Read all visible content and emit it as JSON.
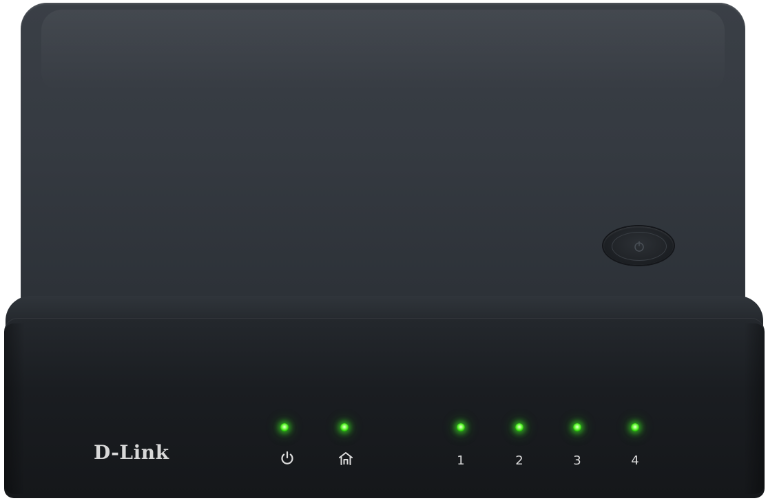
{
  "device": {
    "brand": "D-Link",
    "body_color": "#1c1f23",
    "led_color": "#4cff2a",
    "wps_button": {
      "icon": "wps-icon"
    }
  },
  "indicators": [
    {
      "id": "power",
      "icon": "power-icon",
      "label": "",
      "lit": true
    },
    {
      "id": "internet",
      "icon": "home-icon",
      "label": "",
      "lit": true
    },
    {
      "id": "port-1",
      "icon": "",
      "label": "1",
      "lit": true
    },
    {
      "id": "port-2",
      "icon": "",
      "label": "2",
      "lit": true
    },
    {
      "id": "port-3",
      "icon": "",
      "label": "3",
      "lit": true
    },
    {
      "id": "port-4",
      "icon": "",
      "label": "4",
      "lit": true
    }
  ]
}
